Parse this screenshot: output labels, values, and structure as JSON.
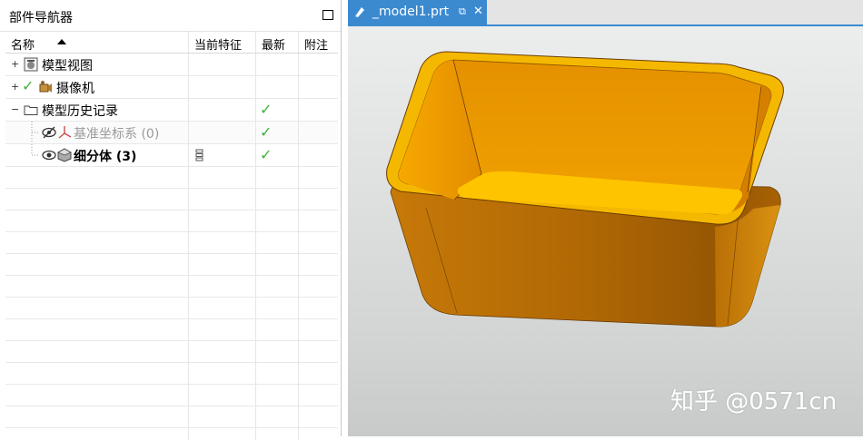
{
  "navigator": {
    "title": "部件导航器",
    "columns": {
      "name": "名称",
      "current_feature": "当前特征",
      "latest": "最新",
      "notes": "附注"
    },
    "rows": [
      {
        "expander": "+",
        "icon": "model-views-icon",
        "label": "模型视图"
      },
      {
        "expander": "+",
        "icon": "camera-icon",
        "label": "摄像机",
        "checked": true
      },
      {
        "expander": "−",
        "icon": "folder-icon",
        "label": "模型历史记录",
        "latest": "✓"
      },
      {
        "icon": "datum-csys-icon",
        "label": "基准坐标系 (0)",
        "latest": "✓",
        "disabled": true
      },
      {
        "icon": "body-icon",
        "label": "细分体 (3)",
        "latest": "✓",
        "current": true
      }
    ],
    "accent_check": "#3db23d"
  },
  "viewport": {
    "tab_label": "_model1.prt",
    "tab_color": "#3b8ad0",
    "model_color": "#e7a21b",
    "watermark": "知乎 @0571cn"
  }
}
